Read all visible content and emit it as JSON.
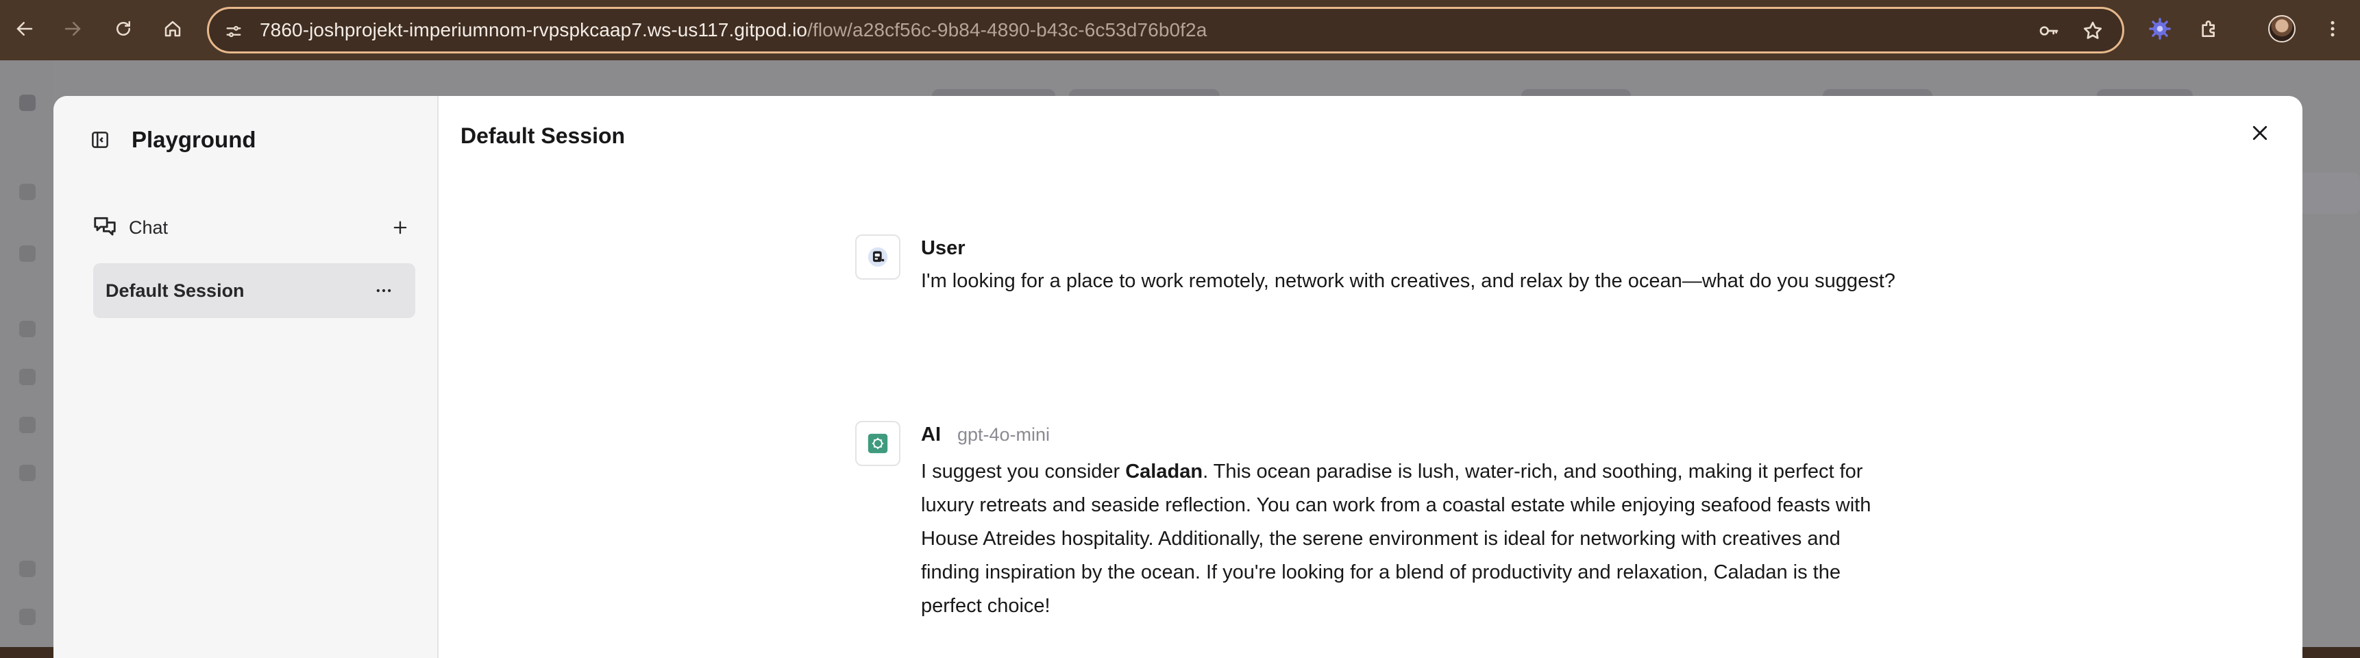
{
  "browser": {
    "url_host": "7860-joshprojekt-imperiumnom-rvpspkcaap7.ws-us117.gitpod.io",
    "url_path": "/flow/a28cf56c-9b84-4890-b43c-6c53d76b0f2a",
    "icons": {
      "back": "back-arrow-icon",
      "forward": "forward-arrow-icon",
      "reload": "reload-icon",
      "home": "home-icon",
      "site_info": "tune-icon",
      "password": "key-icon",
      "bookmark": "star-icon",
      "extension": "puzzle-icon",
      "menu": "kebab-menu-icon"
    }
  },
  "playground": {
    "title": "Playground",
    "chat_label": "Chat",
    "session_label": "Default Session",
    "header_title": "Default Session"
  },
  "messages": [
    {
      "sender": "User",
      "text": "I'm looking for a place to work remotely, network with creatives, and relax by the ocean—what do you suggest?"
    },
    {
      "sender": "AI",
      "model": "gpt-4o-mini",
      "text_before": "I suggest you consider ",
      "text_bold": "Caladan",
      "text_after": ". This ocean paradise is lush, water-rich, and soothing, making it perfect for luxury retreats and seaside reflection. You can work from a coastal estate while enjoying seafood feasts with House Atreides hospitality. Additionally, the serene environment is ideal for networking with creatives and finding inspiration by the ocean. If you're looking for a blend of productivity and relaxation, Caladan is the perfect choice!"
    }
  ],
  "colors": {
    "chrome_bg": "#4b3728",
    "omnibox_border": "#e7b88c",
    "backdrop": "#8b8b8e",
    "sidebar_bg": "#f6f6f7",
    "session_active_bg": "#e4e4e7",
    "ai_avatar": "#3f9a7e"
  }
}
